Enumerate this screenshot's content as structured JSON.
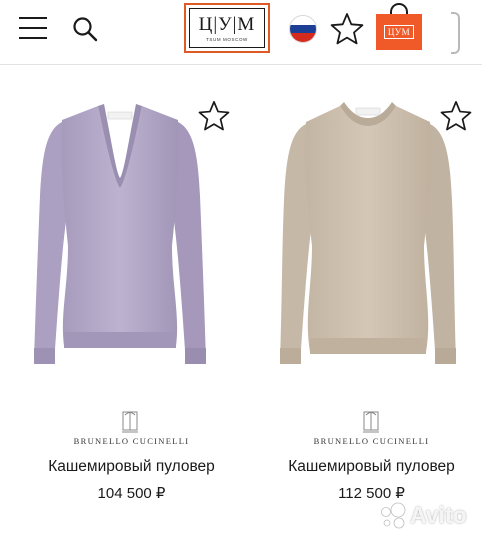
{
  "header": {
    "logo": {
      "letters": "ЦУМ",
      "subtitle": "TSUM MOSCOW"
    },
    "bag_label": "ЦУМ",
    "icons": {
      "menu": "hamburger-menu-icon",
      "search": "search-icon",
      "language": "russian-flag-icon",
      "favorites": "star-outline-icon",
      "bag": "shopping-bag-icon"
    },
    "colors": {
      "brand_orange": "#ef5a28",
      "flag_white": "#ffffff",
      "flag_blue": "#1c3f95",
      "flag_red": "#d52b1e"
    }
  },
  "products": [
    {
      "brand": "BRUNELLO CUCINELLI",
      "name": "Кашемировый пуловер",
      "price": "104 500 ₽",
      "color_hex": "#b5a9c8",
      "neckline": "v-neck"
    },
    {
      "brand": "BRUNELLO CUCINELLI",
      "name": "Кашемировый пуловер",
      "price": "112 500 ₽",
      "color_hex": "#cdbfae",
      "neckline": "crew-neck"
    }
  ],
  "watermark": {
    "text": "Avito"
  }
}
